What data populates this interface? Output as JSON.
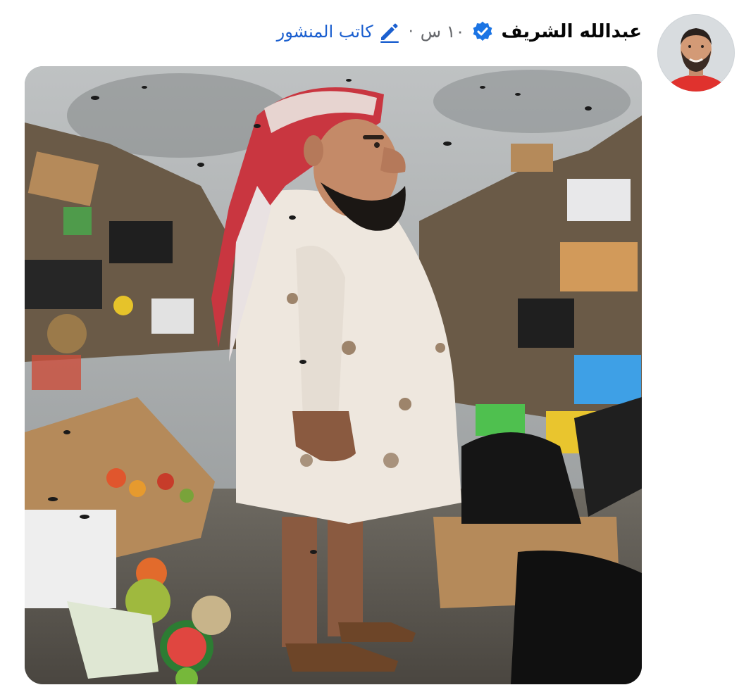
{
  "post": {
    "author": {
      "name": "عبدالله الشريف",
      "avatar_icon": "profile-photo",
      "verified": true,
      "verified_icon": "verified-badge-icon"
    },
    "timestamp": "١٠ س",
    "separator": "·",
    "author_badge": {
      "label": "كاتب المنشور",
      "icon": "pencil-icon"
    },
    "image": {
      "description_icon": "post-image"
    }
  },
  "colors": {
    "name": "#050505",
    "meta": "#65676b",
    "accent": "#1b5fcf",
    "verified": "#1b74e4"
  }
}
